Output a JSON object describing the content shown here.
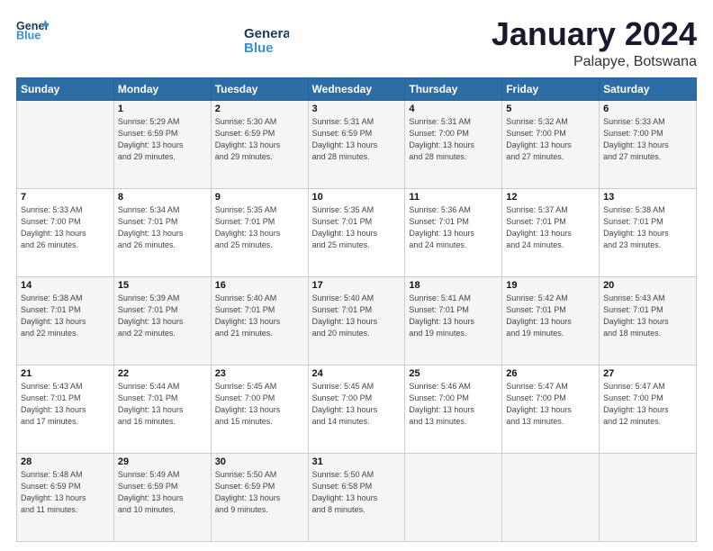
{
  "header": {
    "logo_line1": "General",
    "logo_line2": "Blue",
    "month": "January 2024",
    "location": "Palapye, Botswana"
  },
  "weekdays": [
    "Sunday",
    "Monday",
    "Tuesday",
    "Wednesday",
    "Thursday",
    "Friday",
    "Saturday"
  ],
  "weeks": [
    [
      {
        "day": "",
        "info": ""
      },
      {
        "day": "1",
        "info": "Sunrise: 5:29 AM\nSunset: 6:59 PM\nDaylight: 13 hours\nand 29 minutes."
      },
      {
        "day": "2",
        "info": "Sunrise: 5:30 AM\nSunset: 6:59 PM\nDaylight: 13 hours\nand 29 minutes."
      },
      {
        "day": "3",
        "info": "Sunrise: 5:31 AM\nSunset: 6:59 PM\nDaylight: 13 hours\nand 28 minutes."
      },
      {
        "day": "4",
        "info": "Sunrise: 5:31 AM\nSunset: 7:00 PM\nDaylight: 13 hours\nand 28 minutes."
      },
      {
        "day": "5",
        "info": "Sunrise: 5:32 AM\nSunset: 7:00 PM\nDaylight: 13 hours\nand 27 minutes."
      },
      {
        "day": "6",
        "info": "Sunrise: 5:33 AM\nSunset: 7:00 PM\nDaylight: 13 hours\nand 27 minutes."
      }
    ],
    [
      {
        "day": "7",
        "info": "Sunrise: 5:33 AM\nSunset: 7:00 PM\nDaylight: 13 hours\nand 26 minutes."
      },
      {
        "day": "8",
        "info": "Sunrise: 5:34 AM\nSunset: 7:01 PM\nDaylight: 13 hours\nand 26 minutes."
      },
      {
        "day": "9",
        "info": "Sunrise: 5:35 AM\nSunset: 7:01 PM\nDaylight: 13 hours\nand 25 minutes."
      },
      {
        "day": "10",
        "info": "Sunrise: 5:35 AM\nSunset: 7:01 PM\nDaylight: 13 hours\nand 25 minutes."
      },
      {
        "day": "11",
        "info": "Sunrise: 5:36 AM\nSunset: 7:01 PM\nDaylight: 13 hours\nand 24 minutes."
      },
      {
        "day": "12",
        "info": "Sunrise: 5:37 AM\nSunset: 7:01 PM\nDaylight: 13 hours\nand 24 minutes."
      },
      {
        "day": "13",
        "info": "Sunrise: 5:38 AM\nSunset: 7:01 PM\nDaylight: 13 hours\nand 23 minutes."
      }
    ],
    [
      {
        "day": "14",
        "info": "Sunrise: 5:38 AM\nSunset: 7:01 PM\nDaylight: 13 hours\nand 22 minutes."
      },
      {
        "day": "15",
        "info": "Sunrise: 5:39 AM\nSunset: 7:01 PM\nDaylight: 13 hours\nand 22 minutes."
      },
      {
        "day": "16",
        "info": "Sunrise: 5:40 AM\nSunset: 7:01 PM\nDaylight: 13 hours\nand 21 minutes."
      },
      {
        "day": "17",
        "info": "Sunrise: 5:40 AM\nSunset: 7:01 PM\nDaylight: 13 hours\nand 20 minutes."
      },
      {
        "day": "18",
        "info": "Sunrise: 5:41 AM\nSunset: 7:01 PM\nDaylight: 13 hours\nand 19 minutes."
      },
      {
        "day": "19",
        "info": "Sunrise: 5:42 AM\nSunset: 7:01 PM\nDaylight: 13 hours\nand 19 minutes."
      },
      {
        "day": "20",
        "info": "Sunrise: 5:43 AM\nSunset: 7:01 PM\nDaylight: 13 hours\nand 18 minutes."
      }
    ],
    [
      {
        "day": "21",
        "info": "Sunrise: 5:43 AM\nSunset: 7:01 PM\nDaylight: 13 hours\nand 17 minutes."
      },
      {
        "day": "22",
        "info": "Sunrise: 5:44 AM\nSunset: 7:01 PM\nDaylight: 13 hours\nand 16 minutes."
      },
      {
        "day": "23",
        "info": "Sunrise: 5:45 AM\nSunset: 7:00 PM\nDaylight: 13 hours\nand 15 minutes."
      },
      {
        "day": "24",
        "info": "Sunrise: 5:45 AM\nSunset: 7:00 PM\nDaylight: 13 hours\nand 14 minutes."
      },
      {
        "day": "25",
        "info": "Sunrise: 5:46 AM\nSunset: 7:00 PM\nDaylight: 13 hours\nand 13 minutes."
      },
      {
        "day": "26",
        "info": "Sunrise: 5:47 AM\nSunset: 7:00 PM\nDaylight: 13 hours\nand 13 minutes."
      },
      {
        "day": "27",
        "info": "Sunrise: 5:47 AM\nSunset: 7:00 PM\nDaylight: 13 hours\nand 12 minutes."
      }
    ],
    [
      {
        "day": "28",
        "info": "Sunrise: 5:48 AM\nSunset: 6:59 PM\nDaylight: 13 hours\nand 11 minutes."
      },
      {
        "day": "29",
        "info": "Sunrise: 5:49 AM\nSunset: 6:59 PM\nDaylight: 13 hours\nand 10 minutes."
      },
      {
        "day": "30",
        "info": "Sunrise: 5:50 AM\nSunset: 6:59 PM\nDaylight: 13 hours\nand 9 minutes."
      },
      {
        "day": "31",
        "info": "Sunrise: 5:50 AM\nSunset: 6:58 PM\nDaylight: 13 hours\nand 8 minutes."
      },
      {
        "day": "",
        "info": ""
      },
      {
        "day": "",
        "info": ""
      },
      {
        "day": "",
        "info": ""
      }
    ]
  ]
}
